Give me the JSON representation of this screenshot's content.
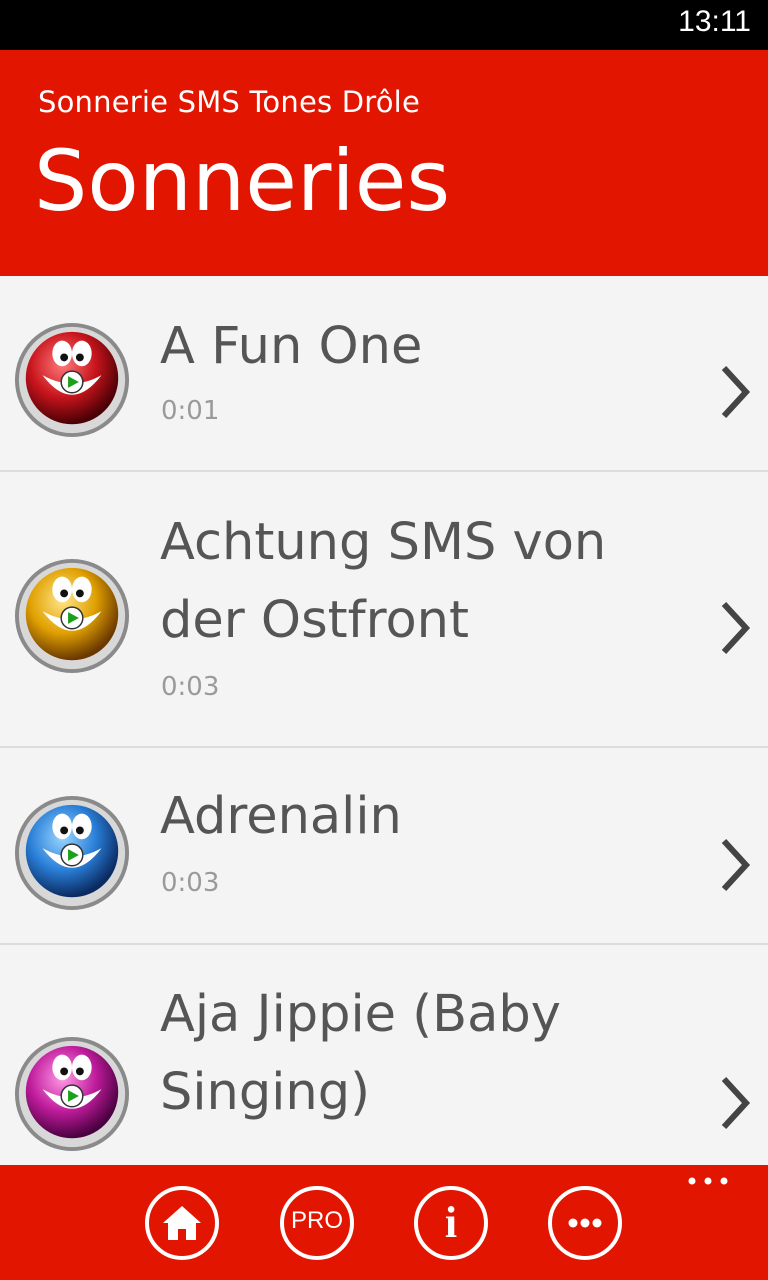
{
  "status": {
    "time": "13:11"
  },
  "header": {
    "app_title": "Sonnerie SMS Tones Drôle",
    "page_title": "Sonneries"
  },
  "list": {
    "items": [
      {
        "title": "A Fun One",
        "duration": "0:01",
        "icon": "smiley-play-icon",
        "color": "#c8141c"
      },
      {
        "title": "Achtung SMS von der Ostfront",
        "duration": "0:03",
        "icon": "smiley-play-icon",
        "color": "#e0a000"
      },
      {
        "title": "Adrenalin",
        "duration": "0:03",
        "icon": "smiley-play-icon",
        "color": "#2a7fd8"
      },
      {
        "title": "Aja Jippie (Baby Singing)",
        "duration": "",
        "icon": "smiley-play-icon",
        "color": "#c01c9c"
      }
    ]
  },
  "appbar": {
    "buttons": [
      {
        "name": "home",
        "icon": "home-icon"
      },
      {
        "name": "pro",
        "label": "PRO",
        "icon": "pro-icon"
      },
      {
        "name": "info",
        "label": "i",
        "icon": "info-icon"
      },
      {
        "name": "more",
        "icon": "more-icon"
      }
    ]
  },
  "colors": {
    "accent": "#e21500",
    "background": "#f4f4f4"
  }
}
